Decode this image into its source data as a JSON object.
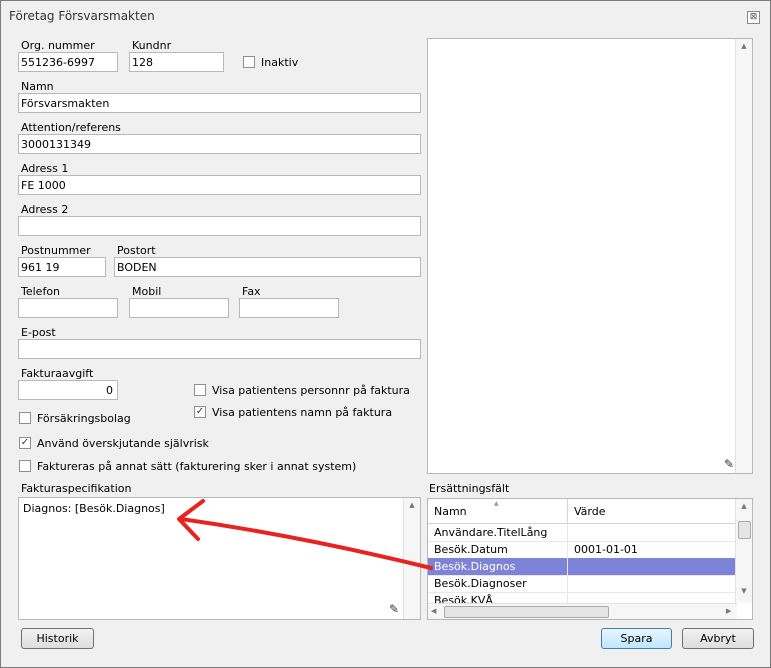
{
  "window": {
    "title": "Företag Försvarsmakten",
    "close_glyph": "⊠"
  },
  "form": {
    "org_label": "Org. nummer",
    "org_value": "551236-6997",
    "kundnr_label": "Kundnr",
    "kundnr_value": "128",
    "inaktiv_label": "Inaktiv",
    "inaktiv_checked": false,
    "namn_label": "Namn",
    "namn_value": "Försvarsmakten",
    "attention_label": "Attention/referens",
    "attention_value": "3000131349",
    "adress1_label": "Adress 1",
    "adress1_value": "FE 1000",
    "adress2_label": "Adress 2",
    "adress2_value": "",
    "postnummer_label": "Postnummer",
    "postnummer_value": "961 19",
    "postort_label": "Postort",
    "postort_value": "BODEN",
    "telefon_label": "Telefon",
    "telefon_value": "",
    "mobil_label": "Mobil",
    "mobil_value": "",
    "fax_label": "Fax",
    "fax_value": "",
    "epost_label": "E-post",
    "epost_value": "",
    "fakturaavgift_label": "Fakturaavgift",
    "fakturaavgift_value": "0",
    "visa_personnr_label": "Visa patientens personnr på faktura",
    "visa_personnr_checked": false,
    "visa_namn_label": "Visa patientens namn på faktura",
    "visa_namn_checked": true,
    "forsakringsbolag_label": "Försäkringsbolag",
    "forsakringsbolag_checked": false,
    "sjalvrisk_label": "Använd överskjutande självrisk",
    "sjalvrisk_checked": true,
    "annat_satt_label": "Faktureras på annat sätt (fakturering sker i annat system)",
    "annat_satt_checked": false
  },
  "fakturaspec": {
    "label": "Fakturaspecifikation",
    "value": "Diagnos: [Besök.Diagnos]"
  },
  "ersattning": {
    "label": "Ersättningsfält",
    "col_namn": "Namn",
    "col_varde": "Värde",
    "rows": [
      {
        "namn": "Användare.TitelLång",
        "varde": ""
      },
      {
        "namn": "Besök.Datum",
        "varde": "0001-01-01"
      },
      {
        "namn": "Besök.Diagnos",
        "varde": ""
      },
      {
        "namn": "Besök.Diagnoser",
        "varde": ""
      },
      {
        "namn": "Besök.KVÅ",
        "varde": ""
      }
    ],
    "selected_index": 2
  },
  "buttons": {
    "historik": "Historik",
    "spara": "Spara",
    "avbryt": "Avbryt"
  },
  "colors": {
    "selection": "#7f83d8",
    "annotation_arrow": "#e8231e",
    "window_bg": "#f0f0f0"
  },
  "glyphs": {
    "check": "✓",
    "scroll_up": "▲",
    "scroll_down": "▼",
    "scroll_left": "◀",
    "scroll_right": "▶",
    "resize_grip": "✎",
    "sort": "▲"
  }
}
